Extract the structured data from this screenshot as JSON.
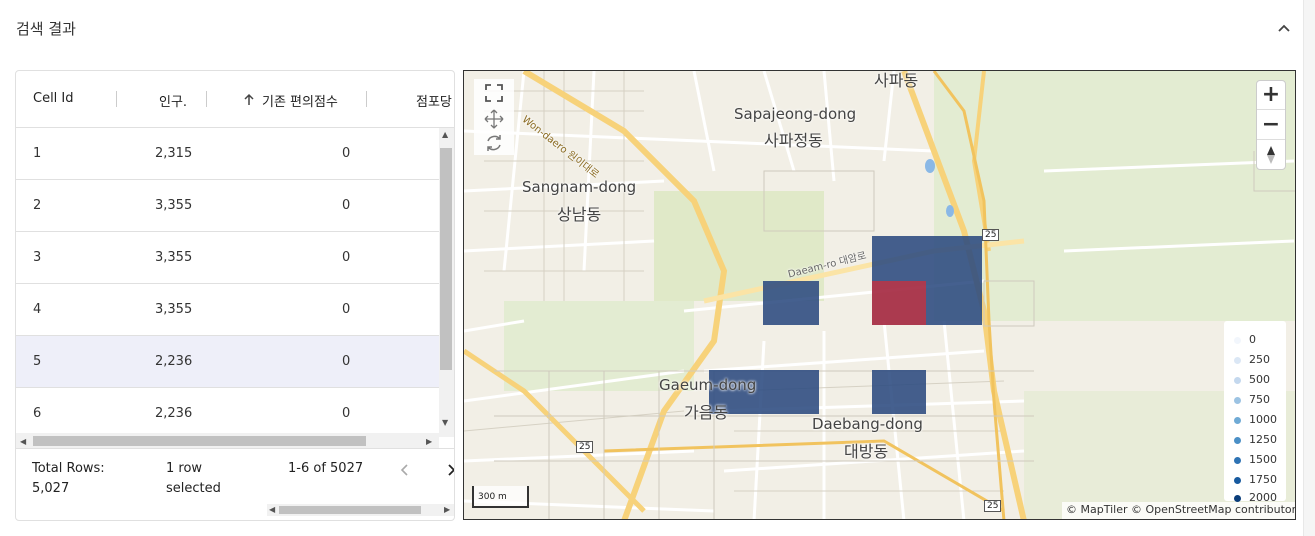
{
  "header": {
    "title": "검색 결과"
  },
  "grid": {
    "columns": [
      "Cell Id",
      "인구.",
      "기존 편의점수",
      "점포당"
    ],
    "rows": [
      {
        "id": "1",
        "pop": "2,315",
        "score": "0"
      },
      {
        "id": "2",
        "pop": "3,355",
        "score": "0"
      },
      {
        "id": "3",
        "pop": "3,355",
        "score": "0"
      },
      {
        "id": "4",
        "pop": "3,355",
        "score": "0"
      },
      {
        "id": "5",
        "pop": "2,236",
        "score": "0",
        "selected": true
      },
      {
        "id": "6",
        "pop": "2,236",
        "score": "0"
      }
    ],
    "footer": {
      "total_rows_label": "Total Rows:",
      "total_rows_value": "5,027",
      "selected_line1": "1 row",
      "selected_line2": "selected",
      "range": "1-6 of 5027"
    }
  },
  "map": {
    "labels": [
      {
        "en": "사파동",
        "ko": ""
      },
      {
        "en": "Sapajeong-dong",
        "ko": "사파정동"
      },
      {
        "en": "Sangnam-dong",
        "ko": "상남동"
      },
      {
        "en": "Gaeum-dong",
        "ko": "가음동"
      },
      {
        "en": "Daebang-dong",
        "ko": "대방동"
      }
    ],
    "roads": {
      "wonidaero": "Won-daero 원이대로",
      "daeamro": "Daeam-ro 대암로",
      "route": "25"
    },
    "scale": "300 m",
    "attribution": "© MapTiler © OpenStreetMap contributors",
    "legend": [
      {
        "label": "0",
        "color": "#f2f6fc"
      },
      {
        "label": "250",
        "color": "#dbe7f5"
      },
      {
        "label": "500",
        "color": "#c4d8ee"
      },
      {
        "label": "750",
        "color": "#9cc3e3"
      },
      {
        "label": "1000",
        "color": "#6faad5"
      },
      {
        "label": "1250",
        "color": "#4a8fc6"
      },
      {
        "label": "1500",
        "color": "#2e73b4"
      },
      {
        "label": "1750",
        "color": "#175a9f"
      },
      {
        "label": "2000",
        "color": "#0a3d7a"
      }
    ],
    "colors": {
      "cell_fill": "#2b4a80",
      "cell_highlight": "#a3263e"
    }
  }
}
